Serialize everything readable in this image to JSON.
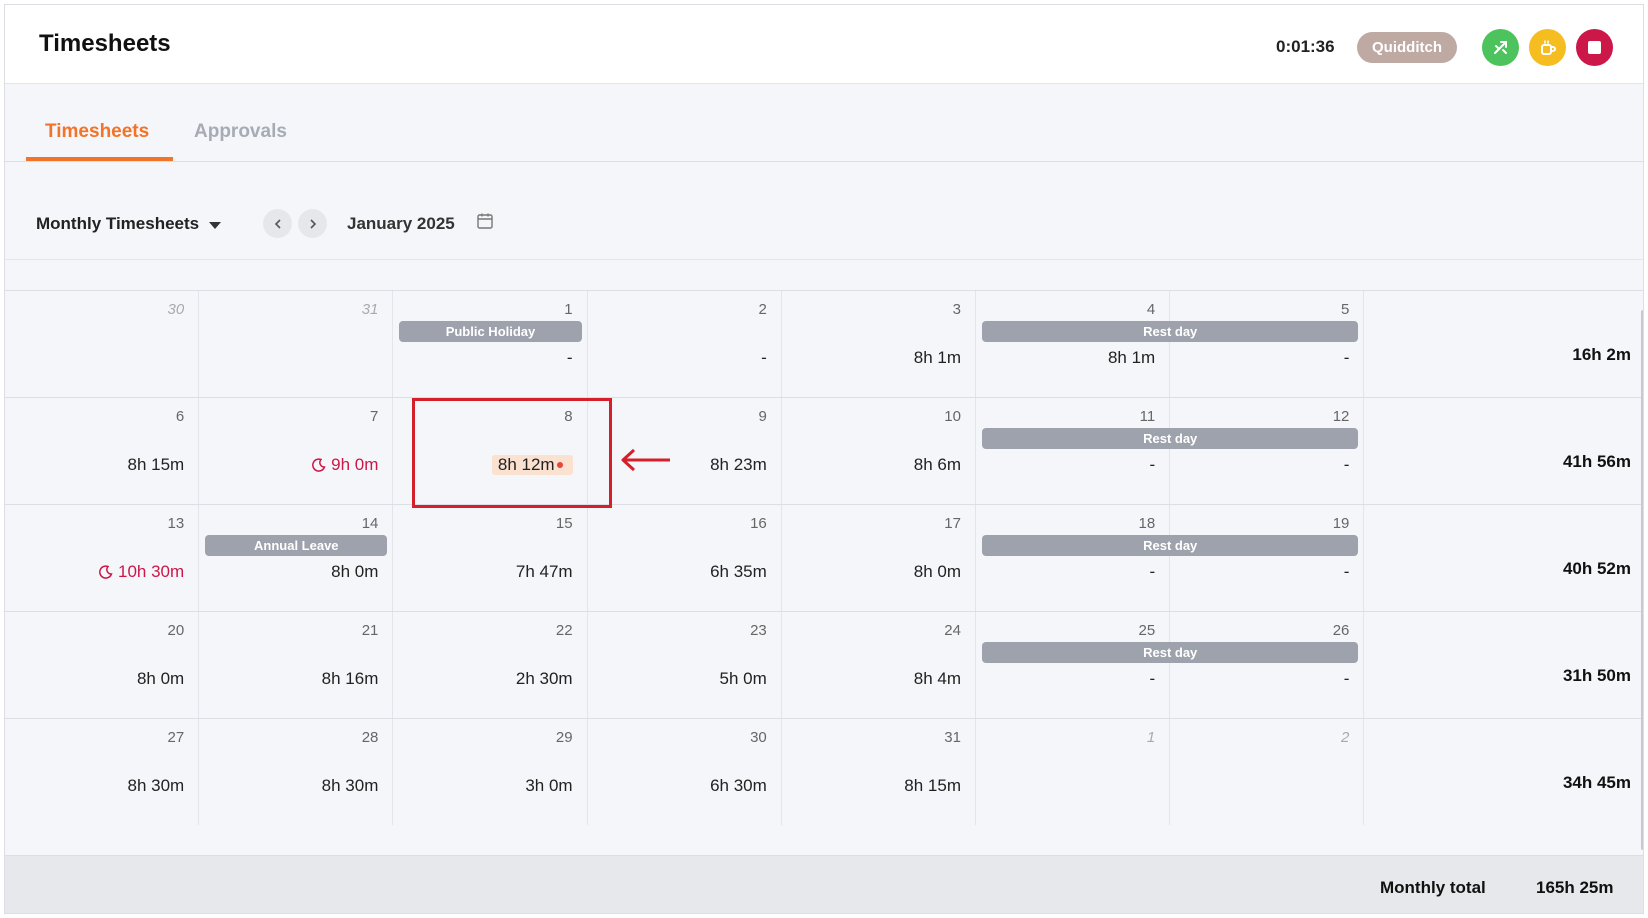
{
  "header": {
    "title": "Timesheets",
    "timer": "0:01:36",
    "project": "Quidditch",
    "colors": {
      "accent": "#f2732a",
      "green": "#4cc35c",
      "yellow": "#f5bd1f",
      "red": "#cc1749"
    }
  },
  "tabs": [
    {
      "label": "Timesheets",
      "active": true
    },
    {
      "label": "Approvals",
      "active": false
    }
  ],
  "toolbar": {
    "view_label": "Monthly Timesheets",
    "month_label": "January 2025"
  },
  "weeks": [
    {
      "days": [
        {
          "num": "30",
          "other": true,
          "hours": ""
        },
        {
          "num": "31",
          "other": true,
          "hours": ""
        },
        {
          "num": "1",
          "hours": "-",
          "tag": "Public Holiday"
        },
        {
          "num": "2",
          "hours": "-"
        },
        {
          "num": "3",
          "hours": "8h 1m"
        },
        {
          "num": "4",
          "hours": "8h 1m",
          "tag": "Rest day"
        },
        {
          "num": "5",
          "hours": "-"
        }
      ],
      "total": "16h 2m"
    },
    {
      "days": [
        {
          "num": "6",
          "hours": "8h 15m"
        },
        {
          "num": "7",
          "hours": "9h 0m",
          "overtime": true
        },
        {
          "num": "8",
          "hours": "8h 12m",
          "highlight": true
        },
        {
          "num": "9",
          "hours": "8h 23m"
        },
        {
          "num": "10",
          "hours": "8h 6m"
        },
        {
          "num": "11",
          "hours": "-",
          "tag": "Rest day"
        },
        {
          "num": "12",
          "hours": "-"
        }
      ],
      "total": "41h 56m"
    },
    {
      "days": [
        {
          "num": "13",
          "hours": "10h 30m",
          "overtime": true
        },
        {
          "num": "14",
          "hours": "8h 0m",
          "tag": "Annual Leave"
        },
        {
          "num": "15",
          "hours": "7h 47m"
        },
        {
          "num": "16",
          "hours": "6h 35m"
        },
        {
          "num": "17",
          "hours": "8h 0m"
        },
        {
          "num": "18",
          "hours": "-",
          "tag": "Rest day"
        },
        {
          "num": "19",
          "hours": "-"
        }
      ],
      "total": "40h 52m"
    },
    {
      "days": [
        {
          "num": "20",
          "hours": "8h 0m"
        },
        {
          "num": "21",
          "hours": "8h 16m"
        },
        {
          "num": "22",
          "hours": "2h 30m"
        },
        {
          "num": "23",
          "hours": "5h 0m"
        },
        {
          "num": "24",
          "hours": "8h 4m"
        },
        {
          "num": "25",
          "hours": "-",
          "tag": "Rest day"
        },
        {
          "num": "26",
          "hours": "-"
        }
      ],
      "total": "31h 50m"
    },
    {
      "days": [
        {
          "num": "27",
          "hours": "8h 30m"
        },
        {
          "num": "28",
          "hours": "8h 30m"
        },
        {
          "num": "29",
          "hours": "3h 0m"
        },
        {
          "num": "30",
          "hours": "6h 30m"
        },
        {
          "num": "31",
          "hours": "8h 15m"
        },
        {
          "num": "1",
          "other": true,
          "hours": ""
        },
        {
          "num": "2",
          "other": true,
          "hours": ""
        }
      ],
      "total": "34h 45m"
    }
  ],
  "footer": {
    "label": "Monthly total",
    "value": "165h 25m"
  }
}
